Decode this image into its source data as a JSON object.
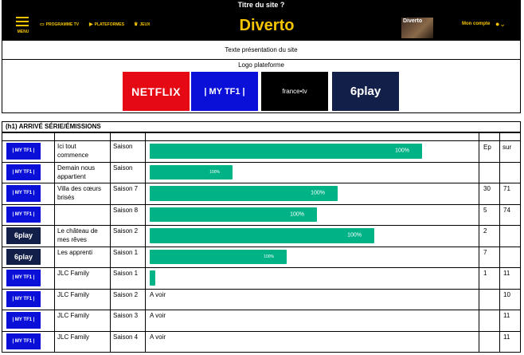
{
  "page_title": "Titre du site ?",
  "nav": {
    "menu_label": "MENU",
    "links": [
      {
        "icon": "tv-icon",
        "label": "PROGRAMME TV"
      },
      {
        "icon": "play-icon",
        "label": "PLATEFORMES"
      },
      {
        "icon": "trophy-icon",
        "label": "JEUX"
      }
    ],
    "brand": "Diverto",
    "promo_text": "Diverto",
    "account_label": "Mon compte",
    "accent_color": "#f5c400"
  },
  "intro_text": "Texte présentation du site",
  "platforms": {
    "heading": "Logo plateforme",
    "tiles": [
      "NETFLIX",
      "| MY TF1 |",
      "france•tv",
      "6play"
    ]
  },
  "section_heading": "(h1) ARRIVÉ SÉRIE/ÉMISSIONS",
  "table": {
    "col_ep": "Ep",
    "col_sur": "sur",
    "bar_color": "#00b386",
    "rows": [
      {
        "platform": "| MY TF1 |",
        "title": "Ici tout commence",
        "season": "Saison",
        "progress": 100,
        "status": "",
        "ep": "",
        "sur": ""
      },
      {
        "platform": "| MY TF1 |",
        "title": "Demain nous appartient",
        "season": "Saison",
        "progress": 100,
        "status": "",
        "ep": "",
        "sur": ""
      },
      {
        "platform": "| MY TF1 |",
        "title": "Villa des cœurs brisés",
        "season": "Saison 7",
        "progress": 100,
        "status": "",
        "ep": "30",
        "sur": "71"
      },
      {
        "platform": "| MY TF1 |",
        "title": "",
        "season": "Saison 8",
        "progress": 100,
        "status": "",
        "ep": "5",
        "sur": "74"
      },
      {
        "platform": "6play",
        "title": "Le château de mes rêves",
        "season": "Saison 2",
        "progress": 100,
        "status": "",
        "ep": "2",
        "sur": ""
      },
      {
        "platform": "6play",
        "title": "Les apprenti",
        "season": "Saison 1",
        "progress": 100,
        "status": "",
        "ep": "7",
        "sur": ""
      },
      {
        "platform": "| MY TF1 |",
        "title": "JLC Family",
        "season": "Saison 1",
        "progress": null,
        "status": "",
        "ep": "1",
        "sur": "11"
      },
      {
        "platform": "| MY TF1 |",
        "title": "JLC Family",
        "season": "Saison 2",
        "progress": null,
        "status": "A voir",
        "ep": "",
        "sur": "10"
      },
      {
        "platform": "| MY TF1 |",
        "title": "JLC Family",
        "season": "Saison 3",
        "progress": null,
        "status": "A voir",
        "ep": "",
        "sur": "11"
      },
      {
        "platform": "| MY TF1 |",
        "title": "JLC Family",
        "season": "Saison 4",
        "progress": null,
        "status": "A voir",
        "ep": "",
        "sur": "11"
      }
    ]
  }
}
